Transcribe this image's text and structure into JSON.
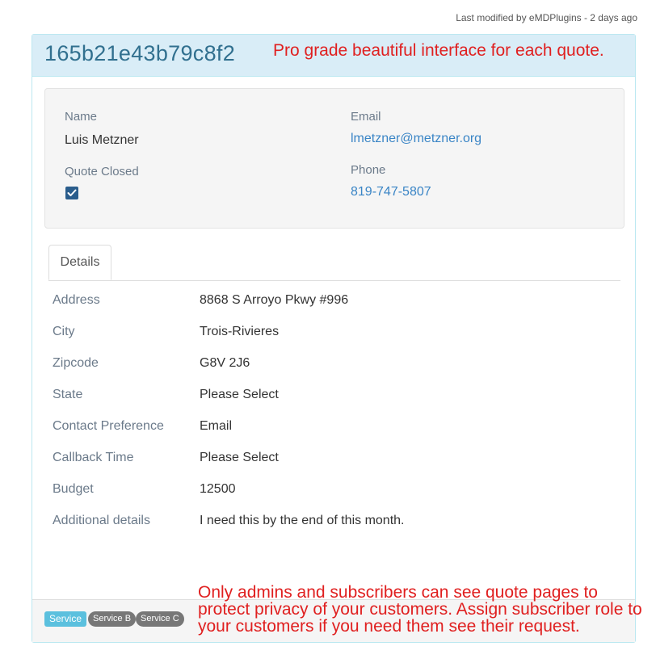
{
  "meta": {
    "last_modified": "Last modified by eMDPlugins - 2 days ago"
  },
  "header": {
    "quote_id": "165b21e43b79c8f2",
    "promo": "Pro grade beautiful interface for each quote."
  },
  "summary": {
    "name_label": "Name",
    "name_value": "Luis Metzner",
    "email_label": "Email",
    "email_value": "lmetzner@metzner.org",
    "quote_closed_label": "Quote Closed",
    "quote_closed": true,
    "phone_label": "Phone",
    "phone_value": "819-747-5807"
  },
  "tabs": [
    {
      "label": "Details"
    }
  ],
  "details": [
    {
      "label": "Address",
      "value": "8868 S Arroyo Pkwy #996"
    },
    {
      "label": "City",
      "value": "Trois-Rivieres"
    },
    {
      "label": "Zipcode",
      "value": "G8V 2J6"
    },
    {
      "label": "State",
      "value": "Please Select"
    },
    {
      "label": "Contact Preference",
      "value": "Email"
    },
    {
      "label": "Callback Time",
      "value": "Please Select"
    },
    {
      "label": "Budget",
      "value": "12500"
    },
    {
      "label": "Additional details",
      "value": "I need this by the end of this month."
    }
  ],
  "footer": {
    "badges": [
      "Service",
      "Service B",
      "Service C"
    ],
    "promo": "Only admins and subscribers can see quote pages to protect privacy of your customers. Assign subscriber role to your customers if you need them see their request."
  },
  "colors": {
    "heading_bg": "#d9edf7",
    "heading_text": "#31708f",
    "promo_text": "#e02020",
    "link": "#3a85c6",
    "checkbox": "#2a5d8c",
    "badge_service": "#5bc0de",
    "badge_other": "#777777"
  }
}
